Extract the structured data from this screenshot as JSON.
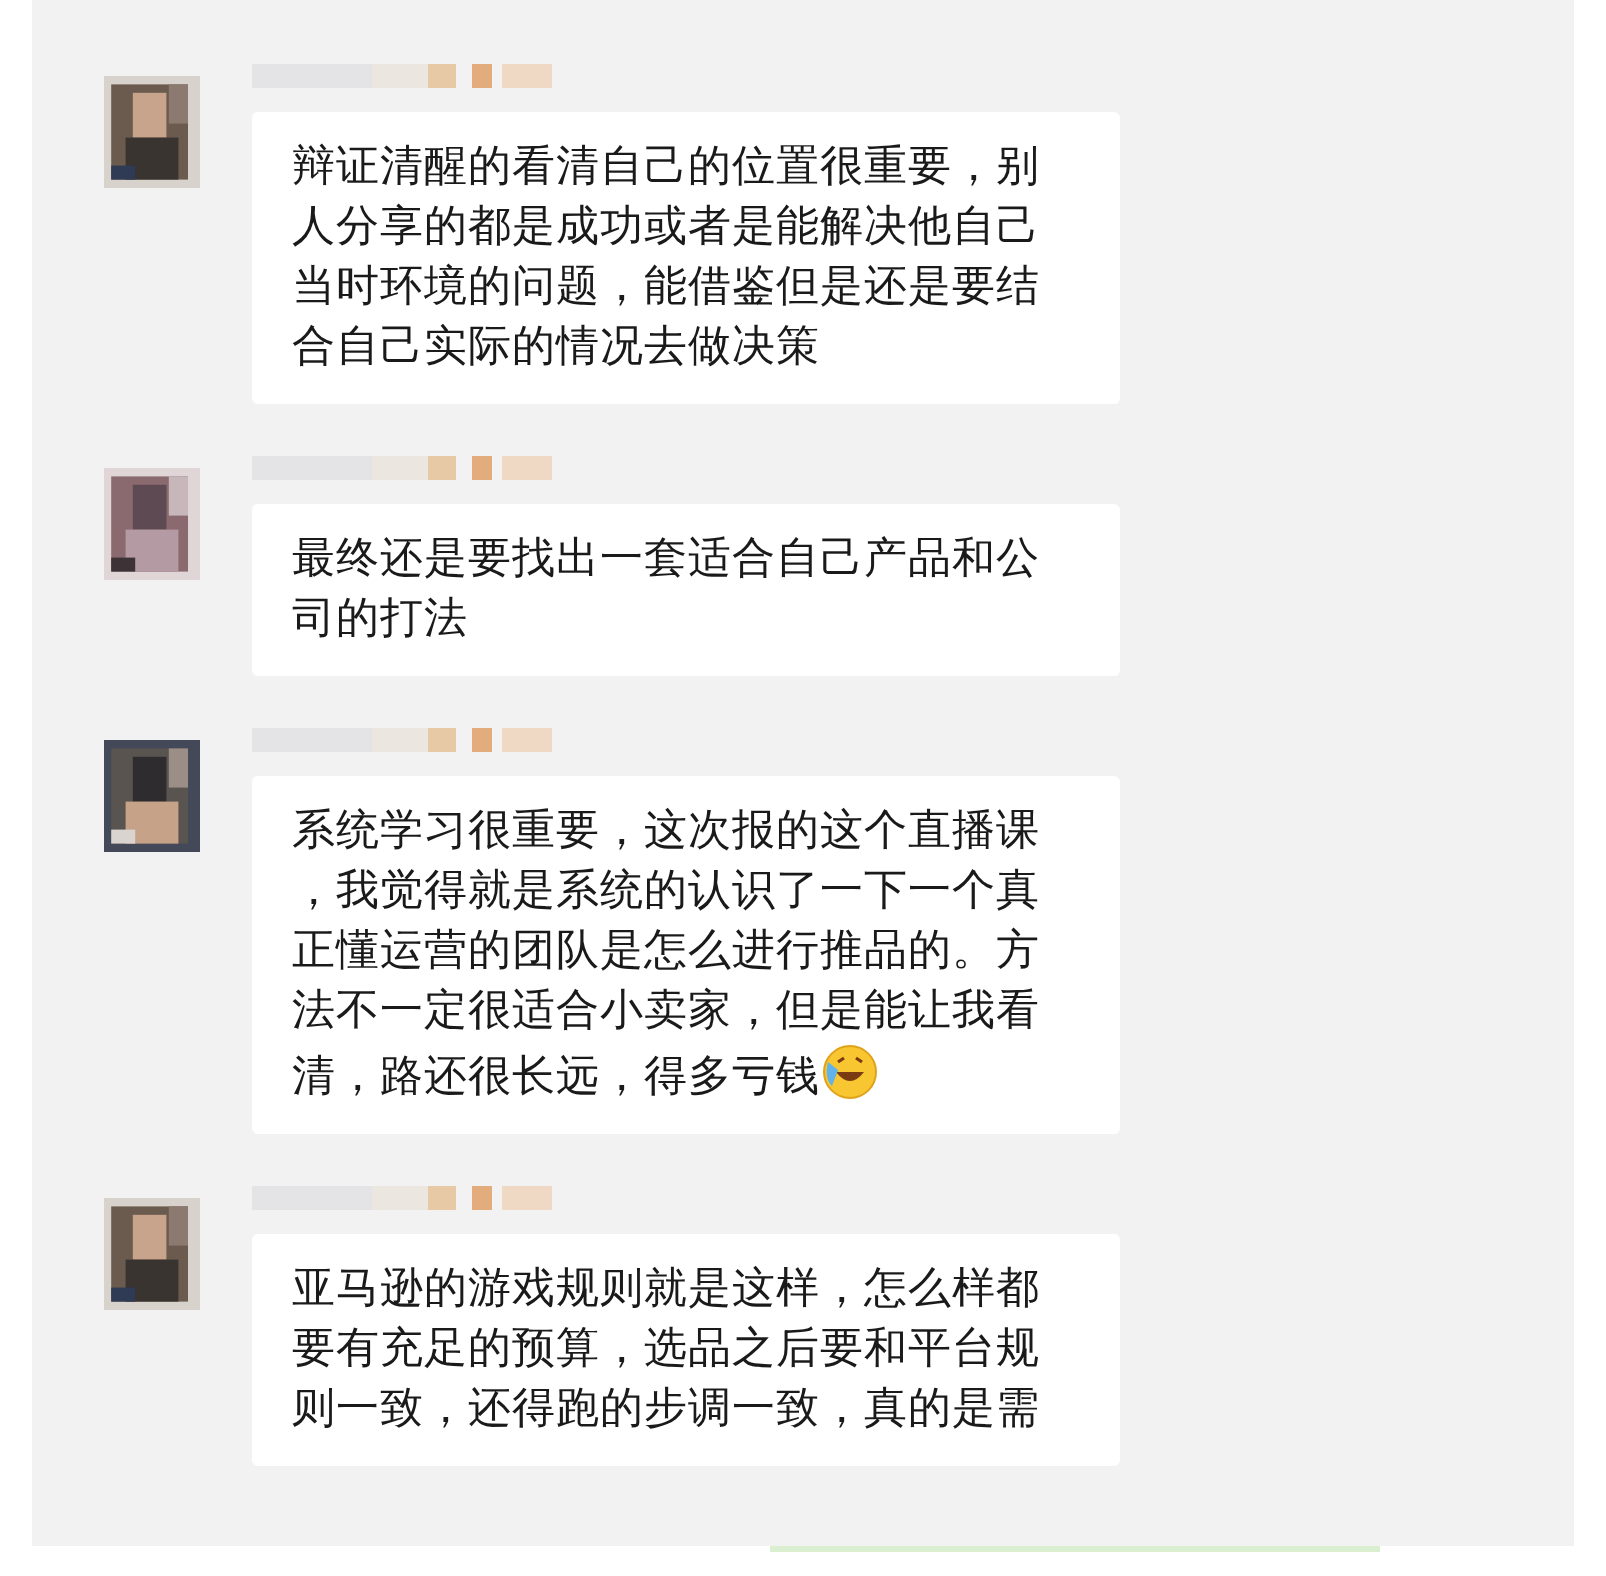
{
  "messages": [
    {
      "text": "辩证清醒的看清自己的位置很重要，别人分享的都是成功或者是能解决他自己当时环境的问题，能借鉴但是还是要结合自己实际的情况去做决策",
      "ends_with_emoji": false
    },
    {
      "text": "最终还是要找出一套适合自己产品和公司的打法",
      "ends_with_emoji": false
    },
    {
      "text": "系统学习很重要，这次报的这个直播课，我觉得就是系统的认识了一下一个真正懂运营的团队是怎么进行推品的。方法不一定很适合小卖家，但是能让我看清，路还很长远，得多亏钱",
      "ends_with_emoji": true
    },
    {
      "text": "亚马逊的游戏规则就是这样，怎么样都要有充足的预算，选品之后要和平台规则一致，还得跑的步调一致，真的是需",
      "ends_with_emoji": false
    }
  ]
}
